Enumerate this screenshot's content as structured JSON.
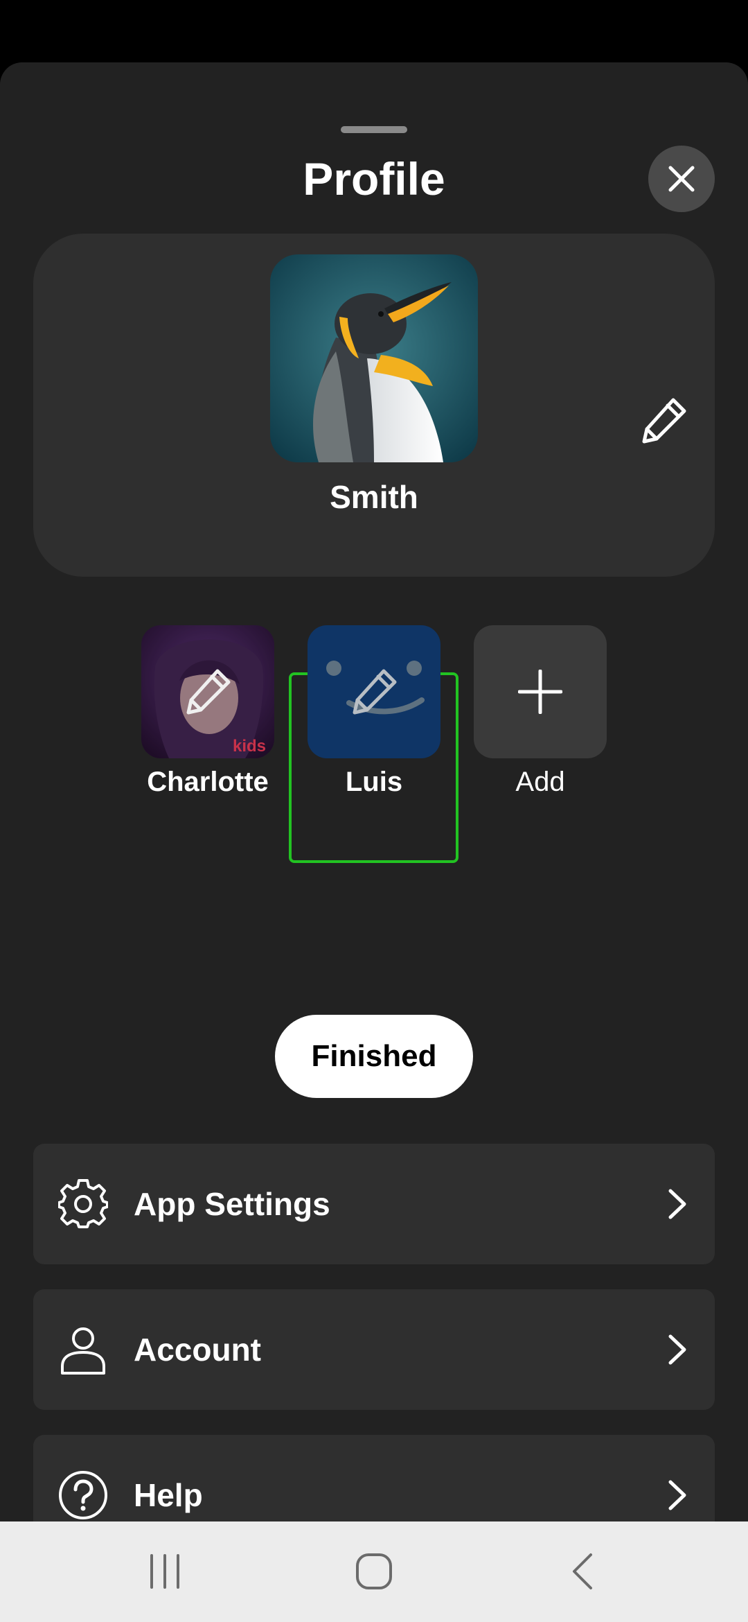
{
  "header": {
    "title": "Profile"
  },
  "current_profile": {
    "name": "Smith",
    "avatar": "penguin-avatar"
  },
  "profiles": [
    {
      "name": "Charlotte",
      "badge": "kids",
      "selected": false
    },
    {
      "name": "Luis",
      "selected": true
    },
    {
      "name": "Add"
    }
  ],
  "finished_label": "Finished",
  "menu": [
    {
      "label": "App Settings",
      "icon": "gear-icon"
    },
    {
      "label": "Account",
      "icon": "person-icon"
    },
    {
      "label": "Help",
      "icon": "help-circle-icon"
    }
  ],
  "colors": {
    "sheet_background": "#222222",
    "card_background": "#2f2f2f",
    "selected_outline": "#22c322",
    "finished_button": "#ffffff"
  }
}
